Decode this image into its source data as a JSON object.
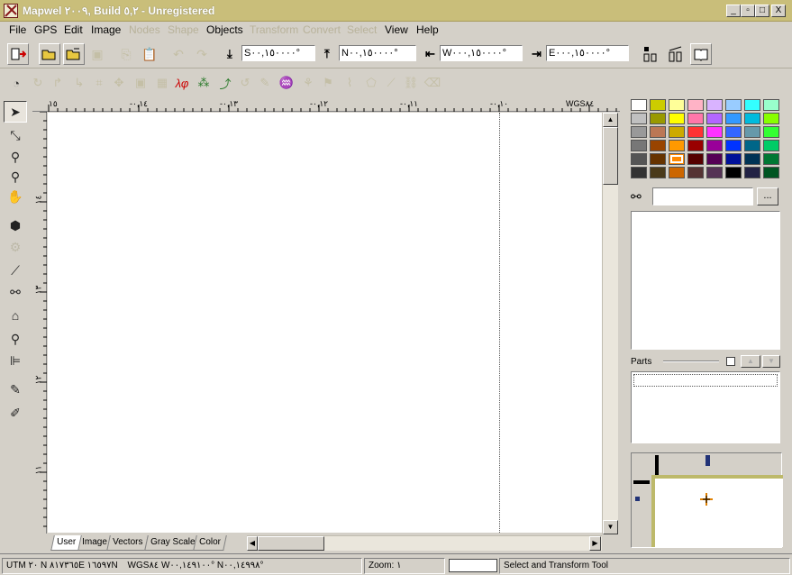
{
  "window": {
    "title": "Mapwel ٢٠٠٩, Build ٥,٢ - Unregistered",
    "minimize_label": "_",
    "maximize_label": "□",
    "close_label": "X"
  },
  "menu": [
    {
      "label": "File",
      "enabled": true
    },
    {
      "label": "GPS",
      "enabled": true
    },
    {
      "label": "Edit",
      "enabled": true
    },
    {
      "label": "Image",
      "enabled": true
    },
    {
      "label": "Nodes",
      "enabled": false
    },
    {
      "label": "Shape",
      "enabled": false
    },
    {
      "label": "Objects",
      "enabled": true
    },
    {
      "label": "Transform",
      "enabled": false
    },
    {
      "label": "Convert",
      "enabled": false
    },
    {
      "label": "Select",
      "enabled": false
    },
    {
      "label": "View",
      "enabled": true
    },
    {
      "label": "Help",
      "enabled": true
    }
  ],
  "coords": {
    "south": "S٠٠,١٥٠٠٠٠°",
    "north": "N٠٠,١٥٠٠٠٠°",
    "west": "W٠٠٠,١٥٠٠٠٠°",
    "east": "E٠٠٠,١٥٠٠٠٠°"
  },
  "ruler": {
    "top_labels": [
      "١٥",
      "-٠,١٤",
      "-٠,١٣",
      "-٠,١٢",
      "-٠,١١",
      "-٠,١٠",
      "WGS٨٤"
    ],
    "left_labels": [
      "١٤",
      "١٣",
      "١٢",
      "١١"
    ]
  },
  "tabs": [
    "User",
    "Image",
    "Vectors",
    "Gray Scale",
    "Color"
  ],
  "active_tab": "User",
  "palette_colors": [
    "#ffffff",
    "#cccc00",
    "#ffff99",
    "#ffb3c6",
    "#d9b3ff",
    "#99ccff",
    "#33ffff",
    "#99ffcc",
    "#c0c0c0",
    "#999900",
    "#ffff00",
    "#ff77aa",
    "#b366ff",
    "#3399ff",
    "#00bbdd",
    "#88ff00",
    "#999999",
    "#bb7755",
    "#ccaa00",
    "#ff3333",
    "#ff33ff",
    "#3366ff",
    "#6699aa",
    "#33ff33",
    "#777777",
    "#994400",
    "#ff9900",
    "#990000",
    "#990099",
    "#0033ff",
    "#006688",
    "#00cc66",
    "#555555",
    "#663300",
    "#ff8800",
    "#550000",
    "#550055",
    "#001199",
    "#003355",
    "#007733",
    "#333333",
    "#4a3a1a",
    "#cc6600",
    "#553333",
    "#553355",
    "#000000",
    "#222244",
    "#005522"
  ],
  "selected_color_index": 34,
  "search": {
    "value": "",
    "button_label": "..."
  },
  "parts_label": "Parts",
  "status": {
    "coords_utm": "UTM ٢٠ N ٨١٧٣٦٥E ١٦٥٩٧N",
    "coords_wgs": "WGS٨٤   W٠٠,١٤٩١٠٠° N٠٠,١٤٩٩٨°",
    "zoom": "Zoom: ١",
    "tool": "Select and Transform Tool"
  }
}
